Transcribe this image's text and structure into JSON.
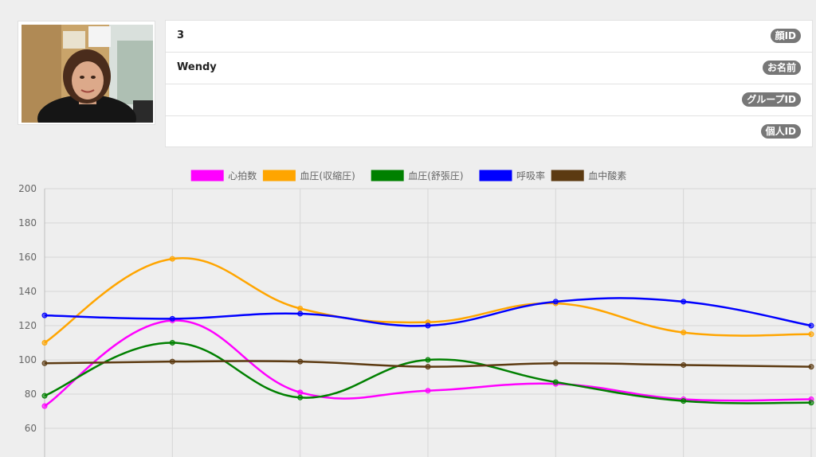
{
  "profile": {
    "photo_alt": "",
    "fields": [
      {
        "value": "3",
        "label": "顔ID"
      },
      {
        "value": "Wendy",
        "label": "お名前"
      },
      {
        "value": "",
        "label": "グループID"
      },
      {
        "value": "",
        "label": "個人ID"
      }
    ]
  },
  "chart_data": {
    "type": "line",
    "title": "",
    "xlabel": "",
    "ylabel": "",
    "ylim": [
      60,
      200
    ],
    "yticks": [
      60,
      80,
      100,
      120,
      140,
      160,
      180,
      200
    ],
    "grid": true,
    "legend": "top",
    "x": [
      1,
      2,
      3,
      4,
      5,
      6,
      7
    ],
    "series": [
      {
        "name": "心拍数",
        "color": "#ff00ff",
        "values": [
          73,
          123,
          81,
          82,
          86,
          77,
          77
        ]
      },
      {
        "name": "血圧(収縮圧)",
        "color": "#ffa500",
        "values": [
          110,
          159,
          130,
          122,
          133,
          116,
          115
        ]
      },
      {
        "name": "血圧(舒張圧)",
        "color": "#008000",
        "values": [
          79,
          110,
          78,
          100,
          87,
          76,
          75
        ]
      },
      {
        "name": "呼吸率",
        "color": "#0000ff",
        "values": [
          126,
          124,
          127,
          120,
          134,
          134,
          120
        ]
      },
      {
        "name": "血中酸素",
        "color": "#5c3a11",
        "values": [
          98,
          99,
          99,
          96,
          98,
          97,
          96
        ]
      }
    ]
  }
}
